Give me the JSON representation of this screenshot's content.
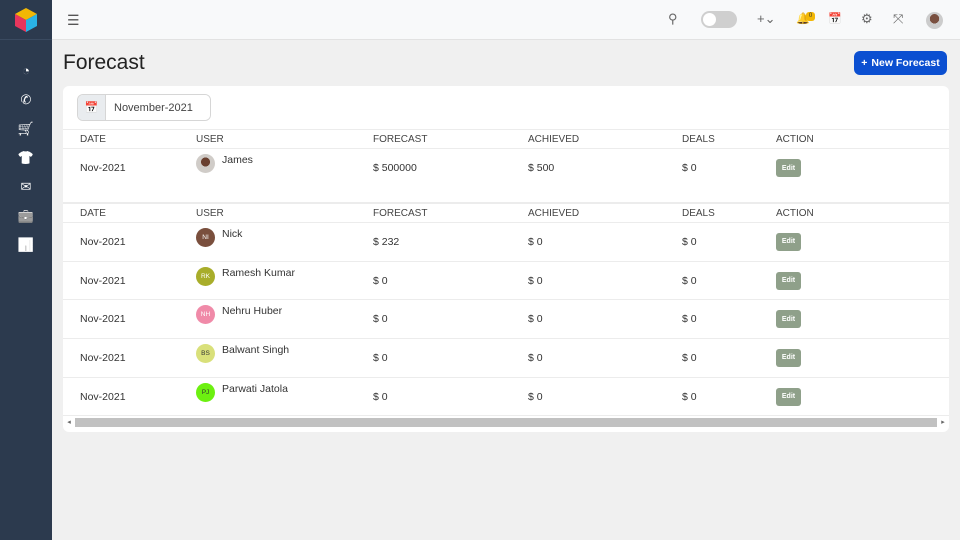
{
  "app": {
    "logo_icon": "cube-logo-icon"
  },
  "sidebar": {
    "items": [
      {
        "name": "dashboard",
        "icon": "gauge-icon",
        "glyph": "◔"
      },
      {
        "name": "calls",
        "icon": "phone-icon",
        "glyph": "✆"
      },
      {
        "name": "cart",
        "icon": "cart-icon",
        "glyph": "🛒"
      },
      {
        "name": "products",
        "icon": "tshirt-icon",
        "glyph": "👕"
      },
      {
        "name": "mail",
        "icon": "envelope-open-icon",
        "glyph": "✉"
      },
      {
        "name": "briefcase",
        "icon": "briefcase-icon",
        "glyph": "💼"
      },
      {
        "name": "reports",
        "icon": "bar-chart-icon",
        "glyph": "📊"
      }
    ]
  },
  "topbar": {
    "menu_glyph": "☰",
    "search_glyph": "⚲",
    "add_glyph": "+⌄",
    "bell_glyph": "🔔",
    "notification_count": "0",
    "calendar_glyph": "📅",
    "settings_glyph": "⚙",
    "fullscreen_glyph": "⤧"
  },
  "page": {
    "title": "Forecast",
    "new_button_label": "New Forecast",
    "new_button_glyph": "+"
  },
  "filter": {
    "calendar_glyph": "📅",
    "month_value": "November-2021"
  },
  "table": {
    "headers": [
      "DATE",
      "USER",
      "FORECAST",
      "ACHIEVED",
      "DEALS",
      "ACTION"
    ],
    "groups": [
      {
        "rows": [
          {
            "date": "Nov-2021",
            "user": "James",
            "initials": "",
            "avatar_color": "#b8b0aa",
            "photo": true,
            "forecast": "$ 500000",
            "achieved": "$ 500",
            "deals": "$ 0",
            "action": "Edit"
          }
        ]
      },
      {
        "rows": [
          {
            "date": "Nov-2021",
            "user": "Nick",
            "initials": "NI",
            "avatar_color": "#7a4f3d",
            "forecast": "$ 232",
            "achieved": "$ 0",
            "deals": "$ 0",
            "action": "Edit"
          },
          {
            "date": "Nov-2021",
            "user": "Ramesh Kumar",
            "initials": "RK",
            "avatar_color": "#a8ad2a",
            "forecast": "$ 0",
            "achieved": "$ 0",
            "deals": "$ 0",
            "action": "Edit"
          },
          {
            "date": "Nov-2021",
            "user": "Nehru Huber",
            "initials": "NH",
            "avatar_color": "#f08aa8",
            "forecast": "$ 0",
            "achieved": "$ 0",
            "deals": "$ 0",
            "action": "Edit"
          },
          {
            "date": "Nov-2021",
            "user": "Balwant Singh",
            "initials": "BS",
            "avatar_color": "#d9e07a",
            "forecast": "$ 0",
            "achieved": "$ 0",
            "deals": "$ 0",
            "action": "Edit"
          },
          {
            "date": "Nov-2021",
            "user": "Parwati Jatola",
            "initials": "PJ",
            "avatar_color": "#6cf010",
            "forecast": "$ 0",
            "achieved": "$ 0",
            "deals": "$ 0",
            "action": "Edit"
          }
        ]
      }
    ]
  }
}
